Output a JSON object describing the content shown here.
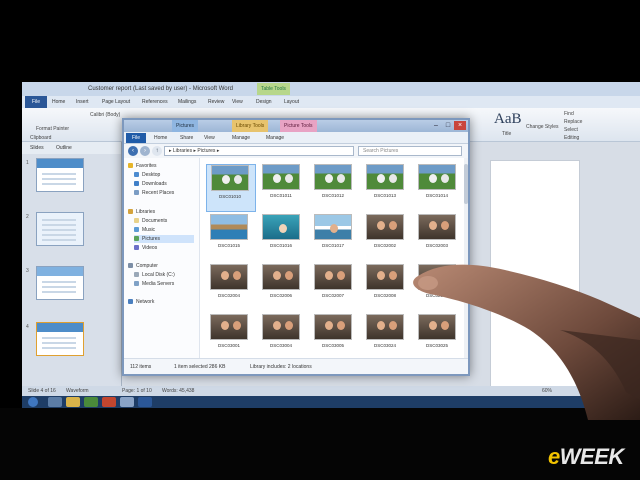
{
  "word": {
    "title": "Customer report (Last saved by user) - Microsoft Word",
    "context_tab": "Table Tools",
    "file_tab": "File",
    "tabs": [
      "Home",
      "Insert",
      "Page Layout",
      "References",
      "Mailings",
      "Review",
      "View",
      "Design",
      "Layout"
    ],
    "ribbon": {
      "font": "Calibri (Body)",
      "styles_sample": "AaB",
      "title_label": "Title",
      "change_styles": "Change Styles",
      "find": "Find",
      "replace": "Replace",
      "select": "Select",
      "editing": "Editing",
      "clipboard": "Clipboard",
      "format_painter": "Format Painter"
    },
    "ppt_pane": {
      "tabs": [
        "Slides",
        "Outline"
      ],
      "slides": [
        "1",
        "2",
        "3",
        "4"
      ]
    },
    "status": {
      "page": "Page: 1 of 10",
      "words": "Words: 45,438",
      "slide": "Slide 4 of 16",
      "theme": "Waveform",
      "zoom": "60%"
    }
  },
  "explorer": {
    "context_tab": "Library Tools",
    "context_tab2": "Picture Tools",
    "title": "Pictures",
    "file_tab": "File",
    "tabs": [
      "Home",
      "Share",
      "View",
      "Manage",
      "Manage"
    ],
    "address": "▸ Libraries ▸ Pictures ▸",
    "search_placeholder": "Search Pictures",
    "nav": {
      "favorites": "Favorites",
      "desktop": "Desktop",
      "downloads": "Downloads",
      "recent": "Recent Places",
      "libraries": "Libraries",
      "documents": "Documents",
      "music": "Music",
      "pictures": "Pictures",
      "videos": "Videos",
      "computer": "Computer",
      "local_disk": "Local Disk (C:)",
      "media_servers": "Media Servers",
      "network": "Network"
    },
    "photos": [
      {
        "name": "DSC01010",
        "scene": "soccer",
        "selected": true
      },
      {
        "name": "DSC01011",
        "scene": "soccer"
      },
      {
        "name": "DSC01012",
        "scene": "soccer"
      },
      {
        "name": "DSC01013",
        "scene": "soccer"
      },
      {
        "name": "DSC01014",
        "scene": "soccer"
      },
      {
        "name": "DSC01015",
        "scene": "coast"
      },
      {
        "name": "DSC01016",
        "scene": "water"
      },
      {
        "name": "DSC01017",
        "scene": "boat"
      },
      {
        "name": "DSC02002",
        "scene": "people"
      },
      {
        "name": "DSC02003",
        "scene": "people"
      },
      {
        "name": "DSC02004",
        "scene": "people"
      },
      {
        "name": "DSC02006",
        "scene": "people"
      },
      {
        "name": "DSC02007",
        "scene": "people"
      },
      {
        "name": "DSC02008",
        "scene": "people"
      },
      {
        "name": "DSC02009",
        "scene": "people"
      },
      {
        "name": "DSC03001",
        "scene": "people"
      },
      {
        "name": "DSC03004",
        "scene": "people"
      },
      {
        "name": "DSC03005",
        "scene": "people"
      },
      {
        "name": "DSC03024",
        "scene": "people"
      },
      {
        "name": "DSC03025",
        "scene": "people"
      }
    ],
    "status": {
      "items": "112 items",
      "selected": "1 item selected  286 KB",
      "library": "Library includes:  2 locations"
    }
  },
  "overlay": {
    "brand": "eWEEK",
    "colors": {
      "brand_e": "#f2c300",
      "brand_rest": "#e8e8e8",
      "accent": "#2b5797"
    }
  }
}
